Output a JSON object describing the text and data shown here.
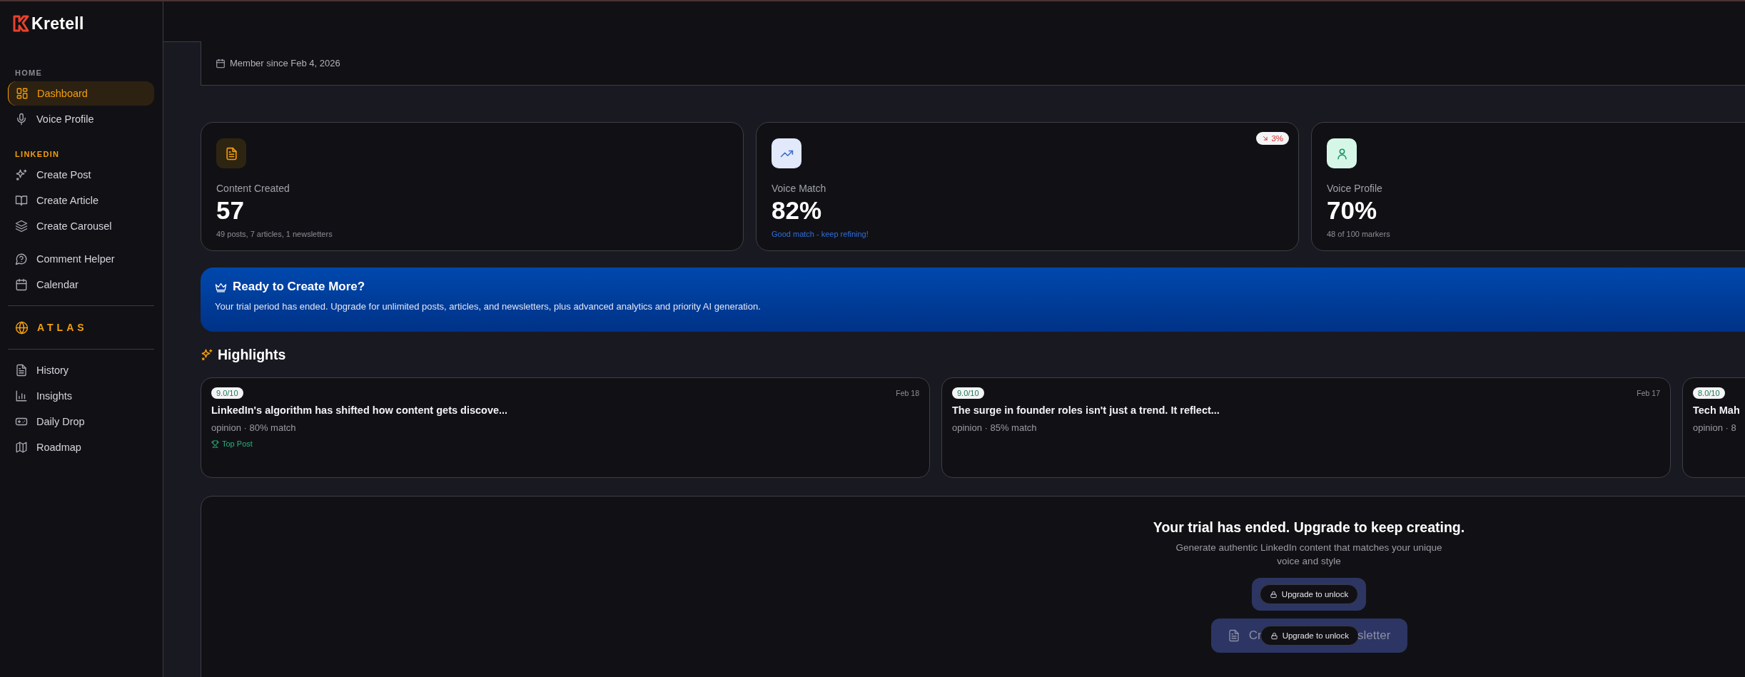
{
  "brand": {
    "name": "Kretell"
  },
  "sidebar": {
    "entries": [
      {
        "kind": "heading",
        "text": "HOME",
        "accent": false
      },
      {
        "kind": "item",
        "label": "Dashboard",
        "selected": true
      },
      {
        "kind": "item",
        "label": "Voice Profile",
        "selected": false
      },
      {
        "kind": "heading",
        "text": "LINKEDIN",
        "accent": true
      },
      {
        "kind": "item",
        "label": "Create Post",
        "selected": false
      },
      {
        "kind": "item",
        "label": "Create Article",
        "selected": false
      },
      {
        "kind": "item",
        "label": "Create Carousel",
        "selected": false
      },
      {
        "kind": "item",
        "label": "Comment Helper",
        "selected": false
      },
      {
        "kind": "item",
        "label": "Calendar",
        "selected": false
      },
      {
        "kind": "divider"
      },
      {
        "kind": "feature",
        "label": "ATLAS"
      },
      {
        "kind": "divider"
      },
      {
        "kind": "item",
        "label": "History",
        "selected": false
      },
      {
        "kind": "item",
        "label": "Insights",
        "selected": false
      },
      {
        "kind": "item",
        "label": "Daily Drop",
        "selected": false
      },
      {
        "kind": "item",
        "label": "Roadmap",
        "selected": false
      }
    ]
  },
  "profile": {
    "member_since": "Member since Feb 4, 2026"
  },
  "stats": [
    {
      "label": "Content Created",
      "value": "57",
      "note": "49 posts, 7 articles, 1 newsletters",
      "emphasis": false,
      "color": "#2e2412"
    },
    {
      "label": "Voice Match",
      "value": "82%",
      "note": "Good match - keep refining!",
      "emphasis": true,
      "color": "#e1e9fb",
      "badge": {
        "text": "3%",
        "falling": true
      }
    },
    {
      "label": "Voice Profile",
      "value": "70%",
      "note": "48 of 100 markers",
      "emphasis": false,
      "color": "#d6f7e7"
    }
  ],
  "banner": {
    "title": "Ready to Create More?",
    "text": "Your trial period has ended. Upgrade for unlimited posts, articles, and newsletters, plus advanced analytics and priority AI generation."
  },
  "highlights": {
    "title": "Highlights",
    "cards": [
      {
        "score": "9.0/10",
        "date": "Feb 18",
        "title": "LinkedIn's algorithm has shifted how content gets discove...",
        "meta": "opinion · 80% match",
        "tag": "Top Post"
      },
      {
        "score": "9.0/10",
        "date": "Feb 17",
        "title": "The surge in founder roles isn't just a trend. It reflect...",
        "meta": "opinion · 85% match"
      },
      {
        "score": "8.0/10",
        "title": "Tech Mah",
        "meta": "opinion · 8"
      }
    ]
  },
  "upgrade": {
    "title": "Your trial has ended. Upgrade to keep creating.",
    "text": "Generate authentic LinkedIn content that matches your unique voice and style",
    "buttons": [
      {
        "kind": "locked",
        "unlock": "Upgrade to unlock"
      },
      {
        "kind": "covered",
        "label_start": "Cr",
        "label_end": "sletter",
        "unlock": "Upgrade to unlock"
      }
    ]
  }
}
